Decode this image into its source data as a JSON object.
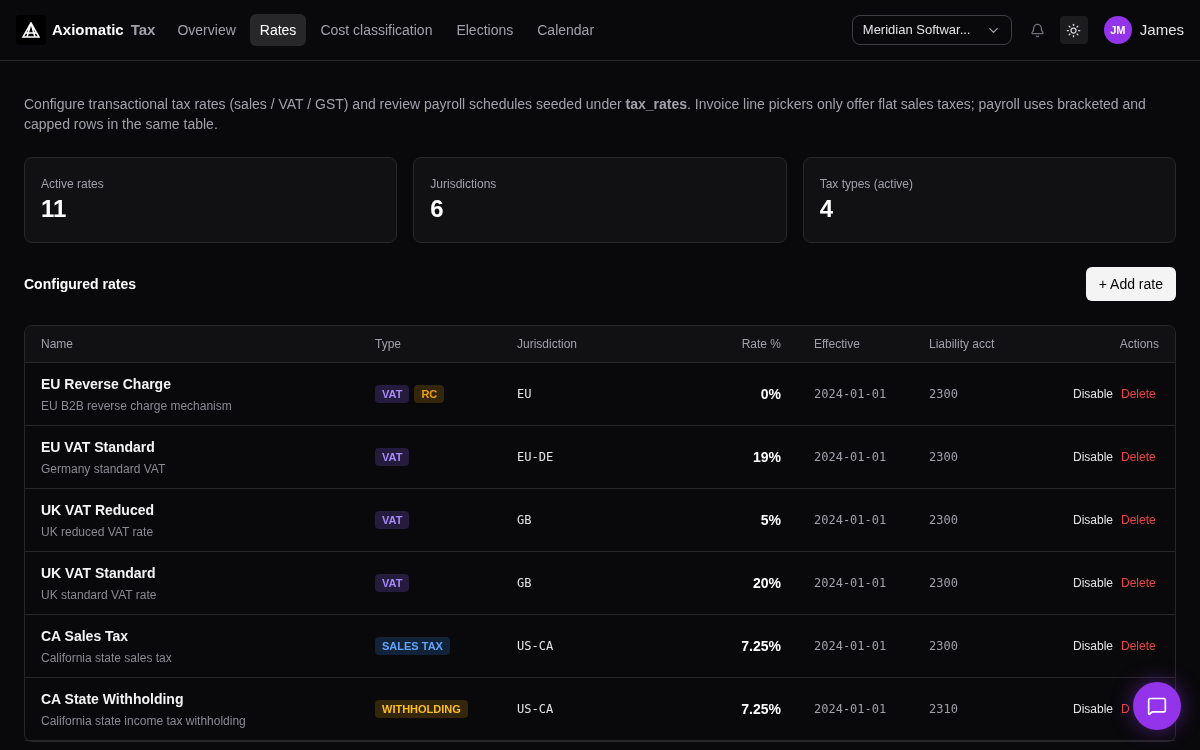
{
  "brand": {
    "name": "Axiomatic",
    "suffix": "Tax"
  },
  "nav": [
    {
      "label": "Overview",
      "selected": false
    },
    {
      "label": "Rates",
      "selected": true
    },
    {
      "label": "Cost classification",
      "selected": false
    },
    {
      "label": "Elections",
      "selected": false
    },
    {
      "label": "Calendar",
      "selected": false
    }
  ],
  "org_select": {
    "value": "Meridian Softwar..."
  },
  "user": {
    "initials": "JM",
    "name": "James"
  },
  "intro": "Configure transactional tax rates (sales / VAT / GST) and review payroll schedules seeded under **tax_rates**. Invoice line pickers only offer flat sales taxes; payroll uses bracketed and capped rows in the same table.",
  "stats": [
    {
      "label": "Active rates",
      "value": "11"
    },
    {
      "label": "Jurisdictions",
      "value": "6"
    },
    {
      "label": "Tax types (active)",
      "value": "4"
    }
  ],
  "section_title": "Configured rates",
  "add_button": "+ Add rate",
  "table": {
    "columns": [
      "Name",
      "Type",
      "Jurisdiction",
      "Rate %",
      "Effective",
      "Liability acct",
      "Actions"
    ],
    "rows": [
      {
        "name": "EU Reverse Charge",
        "description": "EU B2B reverse charge mechanism",
        "tags": [
          {
            "label": "VAT",
            "kind": "vat"
          },
          {
            "label": "RC",
            "kind": "reverse"
          }
        ],
        "jurisdiction": "EU",
        "rate": "0%",
        "effective": "2024-01-01",
        "account": "2300",
        "actions": [
          "Disable",
          "Delete"
        ]
      },
      {
        "name": "EU VAT Standard",
        "description": "Germany standard VAT",
        "tags": [
          {
            "label": "VAT",
            "kind": "vat"
          }
        ],
        "jurisdiction": "EU-DE",
        "rate": "19%",
        "effective": "2024-01-01",
        "account": "2300",
        "actions": [
          "Disable",
          "Delete"
        ]
      },
      {
        "name": "UK VAT Reduced",
        "description": "UK reduced VAT rate",
        "tags": [
          {
            "label": "VAT",
            "kind": "vat"
          }
        ],
        "jurisdiction": "GB",
        "rate": "5%",
        "effective": "2024-01-01",
        "account": "2300",
        "actions": [
          "Disable",
          "Delete"
        ]
      },
      {
        "name": "UK VAT Standard",
        "description": "UK standard VAT rate",
        "tags": [
          {
            "label": "VAT",
            "kind": "vat"
          }
        ],
        "jurisdiction": "GB",
        "rate": "20%",
        "effective": "2024-01-01",
        "account": "2300",
        "actions": [
          "Disable",
          "Delete"
        ]
      },
      {
        "name": "CA Sales Tax",
        "description": "California state sales tax",
        "tags": [
          {
            "label": "SALES TAX",
            "kind": "sales"
          }
        ],
        "jurisdiction": "US-CA",
        "rate": "7.25%",
        "effective": "2024-01-01",
        "account": "2300",
        "actions": [
          "Disable",
          "Delete"
        ]
      },
      {
        "name": "CA State Withholding",
        "description": "California state income tax withholding",
        "tags": [
          {
            "label": "WITHHOLDING",
            "kind": "withholding"
          }
        ],
        "jurisdiction": "US-CA",
        "rate": "7.25%",
        "effective": "2024-01-01",
        "account": "2310",
        "actions": [
          "Disable",
          "D"
        ]
      }
    ]
  }
}
